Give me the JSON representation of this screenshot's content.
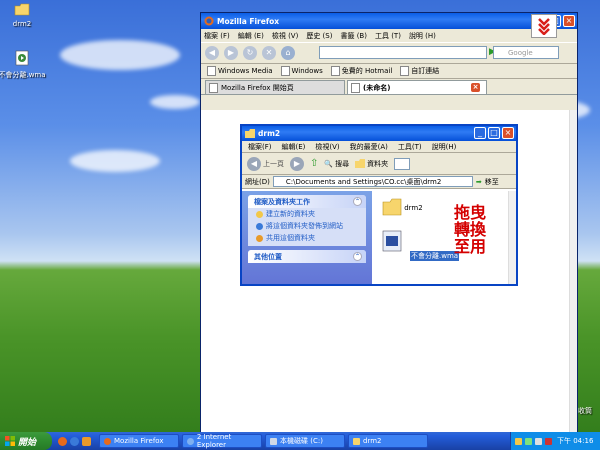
{
  "desktop": {
    "icons": [
      {
        "label": "drm2",
        "icon": "folder-icon"
      },
      {
        "label": "不會分離.wma",
        "icon": "media-file-icon"
      }
    ],
    "right_edge_label": "收筒"
  },
  "firefox": {
    "title": "Mozilla Firefox",
    "menu": [
      "檔案 (F)",
      "編輯 (E)",
      "檢視 (V)",
      "歷史 (S)",
      "書籤 (B)",
      "工具 (T)",
      "說明 (H)"
    ],
    "url_value": "",
    "search_placeholder": "Google",
    "bookmarks": [
      "Windows Media",
      "Windows",
      "免費的 Hotmail",
      "自訂連結"
    ],
    "tabs": [
      {
        "label": "Mozilla Firefox 開始頁",
        "active": false
      },
      {
        "label": "(未命名)",
        "active": true
      }
    ]
  },
  "explorer": {
    "title": "drm2",
    "menu": [
      "檔案(F)",
      "編輯(E)",
      "檢視(V)",
      "我的最愛(A)",
      "工具(T)",
      "說明(H)"
    ],
    "toolbar": {
      "back": "上一頁",
      "search": "搜尋",
      "folders": "資料夾"
    },
    "address_label": "網址(D)",
    "address_value": "C:\\Documents and Settings\\CO.cc\\桌面\\drm2",
    "go_label": "移至",
    "tasks_header": "檔案及資料夾工作",
    "tasks": [
      "建立新的資料夾",
      "將這個資料夾發佈到網站",
      "共用這個資料夾"
    ],
    "other_header": "其他位置",
    "files": [
      {
        "label": "drm2",
        "icon": "folder-icon"
      },
      {
        "label": "不會分離.wma",
        "icon": "wma-file-icon"
      }
    ],
    "drag_hint": "拖曳轉換至用"
  },
  "taskbar": {
    "start_label": "開始",
    "tasks": [
      {
        "label": "Mozilla Firefox",
        "pressed": false
      },
      {
        "label": "2 Internet Explorer",
        "pressed": false
      },
      {
        "label": "本機磁碟 (C:)",
        "pressed": false
      },
      {
        "label": "drm2",
        "pressed": false
      }
    ],
    "clock": "下午 04:16"
  },
  "colors": {
    "title_bar": "#0a5de6",
    "taskbar": "#245edb",
    "start": "#2e8b2e",
    "hint_text": "#d40000"
  }
}
